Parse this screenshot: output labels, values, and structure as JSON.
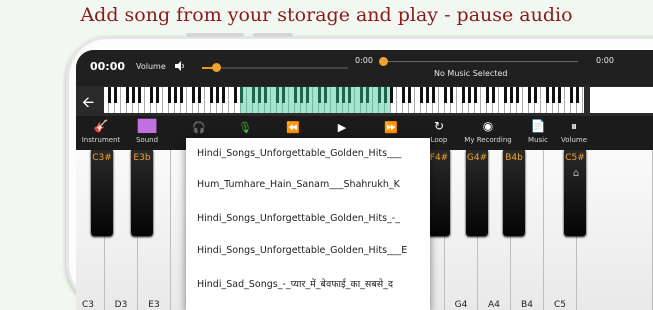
{
  "headline": "Add song from your storage and play - pause audio",
  "player": {
    "time": "00:00",
    "volume_label": "Volume",
    "current_time": "0:00",
    "end_time": "0:00",
    "track_status": "No Music Selected",
    "volume_level": 0.1,
    "progress": 0
  },
  "toolbar": {
    "instrument": "Instrument",
    "sound": "Sound",
    "loop": "Loop",
    "my_recording": "My Recording",
    "music": "Music",
    "volume": "Volume"
  },
  "keys": {
    "black": [
      "C3#",
      "E3b",
      "F4#",
      "G4#",
      "B4b",
      "C5#"
    ],
    "white": [
      "C3",
      "D3",
      "E3",
      "G4",
      "A4",
      "B4",
      "C5"
    ]
  },
  "songs": [
    "Hindi_Songs_Unforgettable_Golden_Hits___",
    "Hum_Tumhare_Hain_Sanam___Shahrukh_K",
    "Hindi_Songs_Unforgettable_Golden_Hits_-_",
    "Hindi_Songs_Unforgettable_Golden_Hits___E",
    "Hindi_Sad_Songs_-_प्यार_में_बेवफाई_का_सबसे_द"
  ],
  "colors": {
    "accent": "#f2a22d",
    "headline": "#8b1a1a",
    "highlight": "#32c896"
  }
}
